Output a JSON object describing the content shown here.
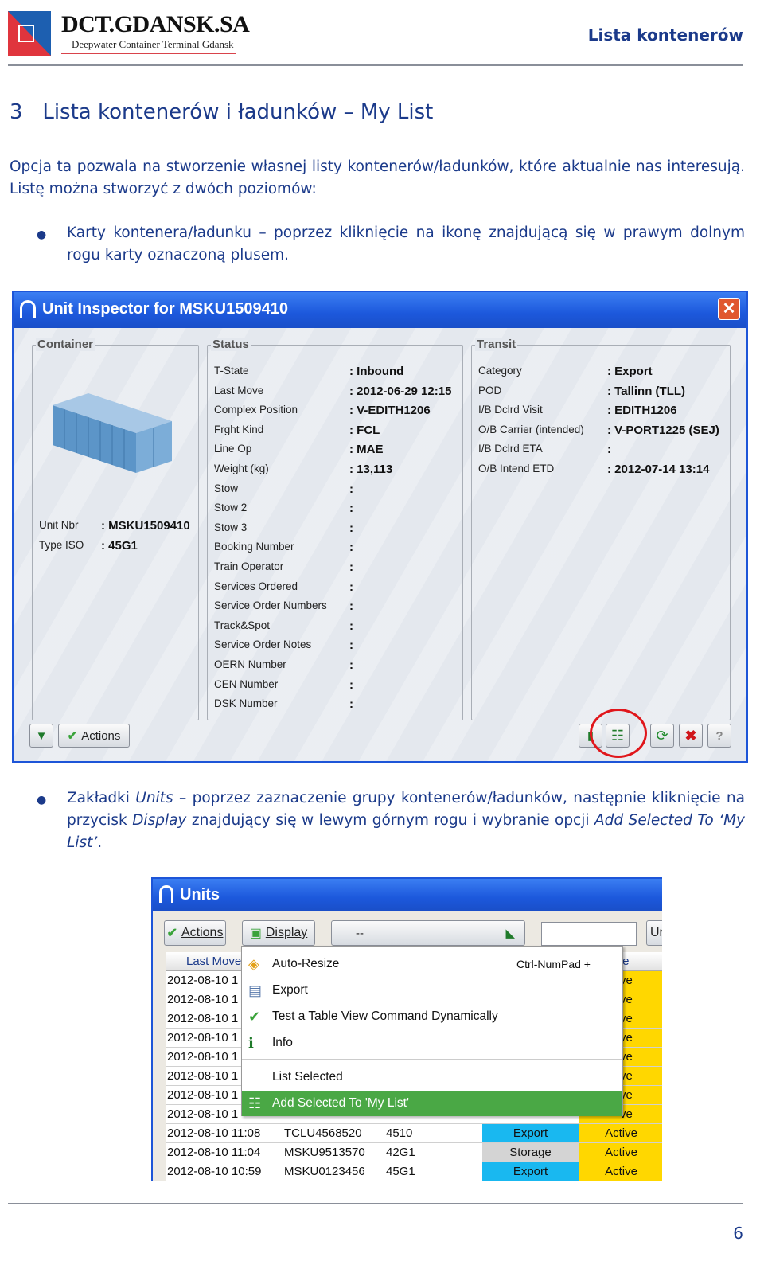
{
  "header": {
    "logo_text": "DCT.GDANSK.SA",
    "logo_subtitle": "Deepwater Container Terminal Gdansk",
    "title": "Lista kontenerów"
  },
  "section": {
    "number": "3",
    "title": "Lista kontenerów i ładunków – My List"
  },
  "intro": "Opcja ta pozwala na stworzenie własnej listy kontenerów/ładunków, które aktualnie nas interesują. Listę można stworzyć z dwóch poziomów:",
  "bullet1": "Karty kontenera/ładunku – poprzez kliknięcie na ikonę znajdującą się w prawym dolnym rogu karty oznaczoną plusem.",
  "bullet2": {
    "p1": "Zakładki ",
    "i1": "Units",
    "p2": " – poprzez zaznaczenie grupy kontenerów/ładunków, następnie kliknięcie na przycisk ",
    "i2": "Display",
    "p3": " znajdujący się w lewym górnym rogu i wybranie opcji ",
    "i3": "Add Selected To ‘My List’",
    "p4": "."
  },
  "inspector": {
    "title": "Unit Inspector for MSKU1509410",
    "container": {
      "title": "Container",
      "fields": [
        {
          "label": "Unit Nbr",
          "value": ": MSKU1509410"
        },
        {
          "label": "Type ISO",
          "value": ": 45G1"
        }
      ]
    },
    "status": {
      "title": "Status",
      "fields": [
        {
          "label": "T-State",
          "value": ": Inbound"
        },
        {
          "label": "Last Move",
          "value": ": 2012-06-29 12:15"
        },
        {
          "label": "Complex Position",
          "value": ": V-EDITH1206"
        },
        {
          "label": "Frght Kind",
          "value": ": FCL"
        },
        {
          "label": "Line Op",
          "value": ": MAE"
        },
        {
          "label": "Weight (kg)",
          "value": ": 13,113"
        },
        {
          "label": "Stow",
          "value": ":"
        },
        {
          "label": "Stow 2",
          "value": ":"
        },
        {
          "label": "Stow 3",
          "value": ":"
        },
        {
          "label": "Booking Number",
          "value": ":"
        },
        {
          "label": "Train Operator",
          "value": ":"
        },
        {
          "label": "Services Ordered",
          "value": ":"
        },
        {
          "label": "Service Order Numbers",
          "value": ":"
        },
        {
          "label": "Track&Spot",
          "value": ":"
        },
        {
          "label": "Service Order Notes",
          "value": ":"
        },
        {
          "label": "OERN Number",
          "value": ":"
        },
        {
          "label": "CEN Number",
          "value": ":"
        },
        {
          "label": "DSK Number",
          "value": ":"
        }
      ]
    },
    "transit": {
      "title": "Transit",
      "fields": [
        {
          "label": "Category",
          "value": ": Export"
        },
        {
          "label": "POD",
          "value": ": Tallinn (TLL)"
        },
        {
          "label": "I/B Dclrd Visit",
          "value": ": EDITH1206"
        },
        {
          "label": "O/B Carrier (intended)",
          "value": ": V-PORT1225 (SEJ)"
        },
        {
          "label": "I/B Dclrd ETA",
          "value": ":"
        },
        {
          "label": "O/B Intend ETD",
          "value": ": 2012-07-14 13:14"
        }
      ]
    },
    "actions_label": "Actions",
    "highlight_color": "#e0161b"
  },
  "units": {
    "title": "Units",
    "actions_label": "Actions",
    "display_label": "Display",
    "filter_value": "--",
    "search_value": "",
    "cut_button": "Ur",
    "headers": {
      "last_move": "Last Move",
      "state": "te"
    },
    "menu": [
      {
        "label": "Auto-Resize",
        "shortcut": "Ctrl-NumPad +",
        "icon": "resize-icon"
      },
      {
        "label": "Export",
        "icon": "document-icon"
      },
      {
        "label": "Test a Table View Command Dynamically",
        "icon": "check-icon"
      },
      {
        "label": "Info",
        "icon": "info-icon"
      },
      {
        "label": "List Selected"
      },
      {
        "label": "Add Selected To 'My List'",
        "icon": "add-list-icon",
        "highlighted": true
      }
    ],
    "partial_rows": [
      {
        "date": "2012-08-10 1",
        "state": "ve"
      },
      {
        "date": "2012-08-10 1",
        "state": "ve"
      },
      {
        "date": "2012-08-10 1",
        "state": "ve"
      },
      {
        "date": "2012-08-10 1",
        "state": "ve"
      },
      {
        "date": "2012-08-10 1",
        "state": "ve"
      },
      {
        "date": "2012-08-10 1",
        "state": "ve"
      },
      {
        "date": "2012-08-10 1",
        "state": "ve"
      },
      {
        "date": "2012-08-10 1",
        "state": "ve"
      }
    ],
    "rows": [
      {
        "date": "2012-08-10 11:08",
        "unit": "TCLU4568520",
        "iso": "4510",
        "category": "Export",
        "state": "Active"
      },
      {
        "date": "2012-08-10 11:04",
        "unit": "MSKU9513570",
        "iso": "42G1",
        "category": "Storage",
        "state": "Active"
      },
      {
        "date": "2012-08-10 10:59",
        "unit": "MSKU0123456",
        "iso": "45G1",
        "category": "Export",
        "state": "Active"
      }
    ],
    "colors": {
      "Export": "#19b8f0",
      "Storage": "#d4d4d4",
      "Active": "#ffd700",
      "menu_highlight": "#4aa845"
    }
  },
  "page_number": "6"
}
